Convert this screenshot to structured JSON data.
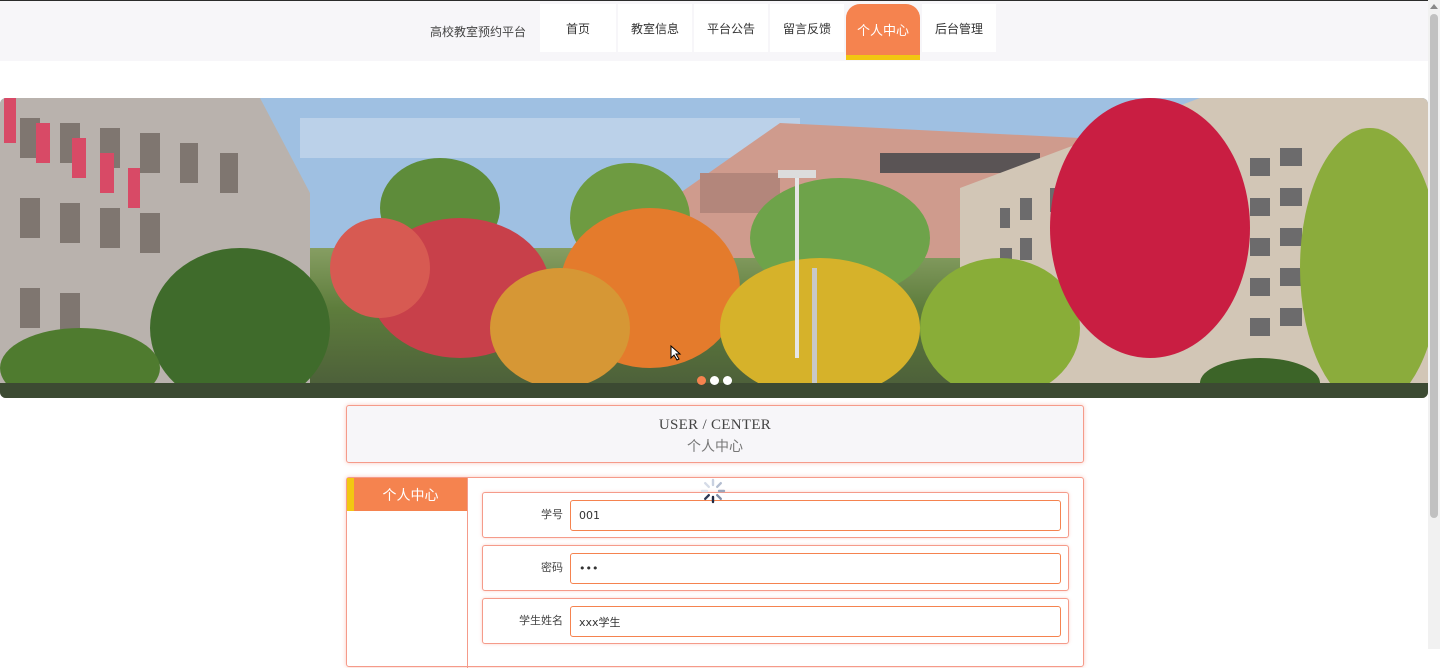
{
  "nav": {
    "brand": "高校教室预约平台",
    "items": [
      {
        "label": "首页"
      },
      {
        "label": "教室信息"
      },
      {
        "label": "平台公告"
      },
      {
        "label": "留言反馈"
      },
      {
        "label": "个人中心"
      },
      {
        "label": "后台管理"
      }
    ],
    "active_index": 4
  },
  "banner": {
    "slide_count": 3,
    "active_slide": 1
  },
  "section": {
    "title_en": "USER / CENTER",
    "title_cn": "个人中心"
  },
  "sidebar": {
    "active_tab": "个人中心"
  },
  "form": {
    "fields": [
      {
        "label": "学号",
        "value": "001"
      },
      {
        "label": "密码",
        "value": "•••"
      },
      {
        "label": "学生姓名",
        "value": "xxx学生"
      }
    ]
  },
  "colors": {
    "accent": "#f5834f",
    "accent_bar": "#f2c711",
    "border": "#f59b8a"
  }
}
